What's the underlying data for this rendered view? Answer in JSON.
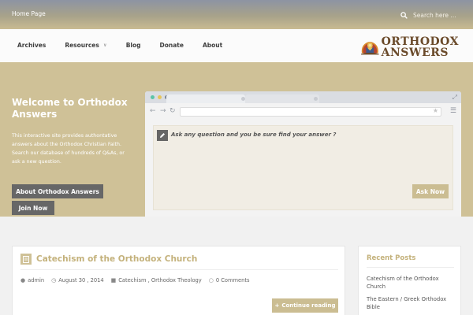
{
  "topbar": {
    "home_link": "Home Page",
    "search_placeholder": "Search here ..."
  },
  "nav": {
    "items": [
      {
        "label": "Archives",
        "has_dropdown": false
      },
      {
        "label": "Resources",
        "has_dropdown": true
      },
      {
        "label": "Blog",
        "has_dropdown": false
      },
      {
        "label": "Donate",
        "has_dropdown": false
      },
      {
        "label": "About",
        "has_dropdown": false
      }
    ]
  },
  "logo": {
    "line1": "ORTHODOX",
    "line2": "ANSWERS",
    "icon": "icon-emblem"
  },
  "hero": {
    "title": "Welcome to Orthodox Answers",
    "intro": "This interactive site provides authontative answers about the Orthodox Christian Faith. Search our database of hundreds of Q&As, or ask a new question.",
    "about_button": "About Orthodox Answers",
    "join_button": "Join Now",
    "ask_prompt": "Ask any question and you be sure find your answer ?",
    "ask_button": "Ask Now"
  },
  "post": {
    "title": "Catechism of the Orthodox Church",
    "author": "admin",
    "date": "August 30 , 2014",
    "categories": "Catechism , Orthodox Theology",
    "comments": "0 Comments",
    "continue_label": "Continue reading"
  },
  "sidebar": {
    "heading": "Recent Posts",
    "posts": [
      "Catechism of the Orthodox Church",
      "The Eastern / Greek Orthodox Bible"
    ]
  },
  "colors": {
    "accent": "#cfc197",
    "accent_text": "#c4b27c",
    "dark_button": "#676767"
  }
}
